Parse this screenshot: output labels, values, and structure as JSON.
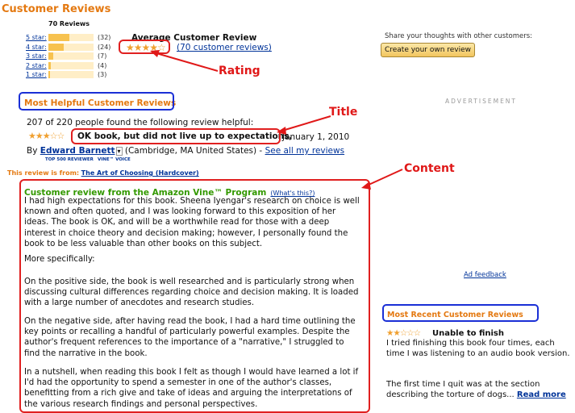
{
  "header": {
    "title": "Customer Reviews"
  },
  "histogram": {
    "total_label": "70 Reviews",
    "rows": [
      {
        "label": "5 star:",
        "count_text": "(32)",
        "count": 32
      },
      {
        "label": "4 star:",
        "count_text": "(24)",
        "count": 24
      },
      {
        "label": "3 star:",
        "count_text": "(7)",
        "count": 7
      },
      {
        "label": "2 star:",
        "count_text": "(4)",
        "count": 4
      },
      {
        "label": "1 star:",
        "count_text": "(3)",
        "count": 3
      }
    ]
  },
  "average": {
    "heading": "Average Customer Review",
    "stars": "★★★★☆",
    "link": "(70 customer reviews)"
  },
  "share": {
    "text": "Share your thoughts with other customers:",
    "button": "Create your own review"
  },
  "annotations": {
    "rating": "Rating",
    "title": "Title",
    "content": "Content"
  },
  "helpful": {
    "heading": "Most Helpful Customer Reviews",
    "found_helpful": "207 of 220 people found the following review helpful:",
    "review_stars": "★★★☆☆",
    "review_title": "OK book, but did not live up to expectations,",
    "review_date": "January 1, 2010",
    "by": "By",
    "reviewer": "Edward Barnett",
    "location": "(Cambridge, MA United States) -",
    "see_all": "See all my reviews",
    "badge1": "TOP 500 REVIEWER",
    "badge2": "VINE™ VOICE",
    "from_prefix": "This review is from:",
    "from_book": "The Art of Choosing (Hardcover)",
    "vine_heading": "Customer review from the Amazon Vine™ Program",
    "whats_this": "(What's this?)",
    "paragraphs": [
      "I had high expectations for this book. Sheena Iyengar's research on choice is well known and often quoted, and I was looking forward to this exposition of her ideas. The book is OK, and will be a worthwhile read for those with a deep interest in choice theory and decision making; however, I personally found the book to be less valuable than other books on this subject.",
      "More specifically:",
      "On the positive side, the book is well researched and is particularly strong when discussing cultural differences regarding choice and decision making. It is loaded with a large number of anecdotes and research studies.",
      "On the negative side, after having read the book, I had a hard time outlining the key points or recalling a handful of particularly powerful examples. Despite the author's frequent references to the importance of a \"narrative,\" I struggled to find the narrative in the book.",
      "In a nutshell, when reading this book I felt as though I would have learned a lot if I'd had the opportunity to spend a semester in one of the author's classes, benefitting from a rich give and take of ideas and arguing the interpretations of the various research findings and personal perspectives."
    ]
  },
  "sidebar": {
    "advertisement": "ADVERTISEMENT",
    "ad_feedback": "Ad feedback",
    "recent_heading": "Most Recent Customer Reviews",
    "recent_stars": "★★☆☆☆",
    "recent_title": "Unable to finish",
    "recent_text1": "I tried finishing this book four times, each time I was listening to an audio book version.",
    "recent_text2": "The first time I quit was at the section describing the torture of dogs...",
    "read_more": "Read more"
  }
}
